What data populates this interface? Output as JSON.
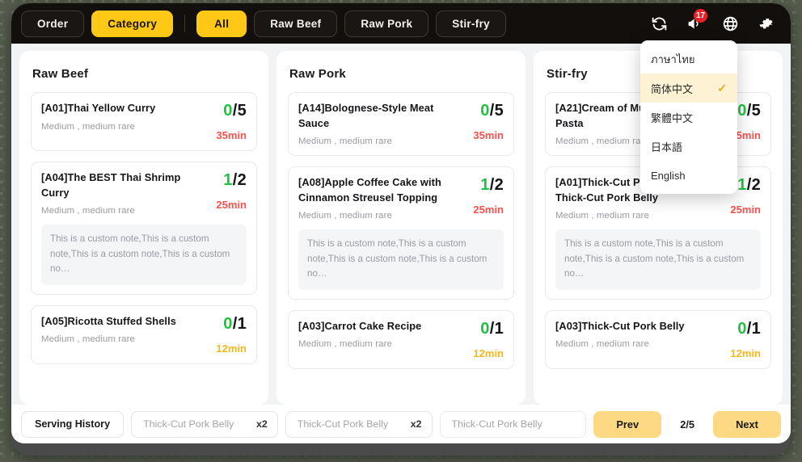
{
  "topbar": {
    "tabs": [
      {
        "label": "Order",
        "active": false
      },
      {
        "label": "Category",
        "active": true
      },
      {
        "label": "All",
        "active": true
      },
      {
        "label": "Raw Beef",
        "active": false
      },
      {
        "label": "Raw Pork",
        "active": false
      },
      {
        "label": "Stir-fry",
        "active": false
      }
    ],
    "icons": [
      {
        "name": "refresh-icon",
        "badge": null
      },
      {
        "name": "announcement-icon",
        "badge": "17"
      },
      {
        "name": "language-globe-icon",
        "badge": null
      },
      {
        "name": "settings-gear-icon",
        "badge": null
      }
    ],
    "accent": "#ffc816"
  },
  "language_menu": {
    "items": [
      {
        "label": "ภาษาไทย",
        "selected": false
      },
      {
        "label": "简体中文",
        "selected": true
      },
      {
        "label": "繁體中文",
        "selected": false
      },
      {
        "label": "日本語",
        "selected": false
      },
      {
        "label": "English",
        "selected": false
      }
    ],
    "check_glyph": "✓",
    "selected_bg": "#fdf3d4"
  },
  "columns": [
    {
      "title": "Raw Beef",
      "cards": [
        {
          "name": "[A01]Thai Yellow Curry",
          "desc": "Medium , medium rare",
          "done": "0",
          "total": "5",
          "time": "35min",
          "time_color": "red",
          "note": null
        },
        {
          "name": "[A04]The BEST Thai Shrimp Curry",
          "desc": "Medium , medium rare",
          "done": "1",
          "total": "2",
          "time": "25min",
          "time_color": "red",
          "note": "This is a custom note,This is a custom note,This is a custom note,This is a custom no…"
        },
        {
          "name": "[A05]Ricotta Stuffed Shells",
          "desc": "Medium , medium rare",
          "done": "0",
          "total": "1",
          "time": "12min",
          "time_color": "amber",
          "note": null
        }
      ]
    },
    {
      "title": "Raw Pork",
      "cards": [
        {
          "name": "[A14]Bolognese-Style Meat Sauce",
          "desc": "Medium , medium rare",
          "done": "0",
          "total": "5",
          "time": "35min",
          "time_color": "red",
          "note": null
        },
        {
          "name": "[A08]Apple Coffee Cake with Cinnamon Streusel Topping",
          "desc": "Medium , medium rare",
          "done": "1",
          "total": "2",
          "time": "25min",
          "time_color": "red",
          "note": "This is a custom note,This is a custom note,This is a custom note,This is a custom no…"
        },
        {
          "name": "[A03]Carrot Cake Recipe",
          "desc": "Medium , medium rare",
          "done": "0",
          "total": "1",
          "time": "12min",
          "time_color": "amber",
          "note": null
        }
      ]
    },
    {
      "title": "Stir-fry",
      "cards": [
        {
          "name": "[A21]Cream of Mushroom Pasta",
          "desc": "Medium , medium rare",
          "done": "0",
          "total": "5",
          "time": "35min",
          "time_color": "red",
          "note": null
        },
        {
          "name": "[A01]Thick-Cut Pork Belly Thick-Cut Pork Belly",
          "desc": "Medium , medium rare",
          "done": "1",
          "total": "2",
          "time": "25min",
          "time_color": "red",
          "note": "This is a custom note,This is a custom note,This is a custom note,This is a custom no…"
        },
        {
          "name": "[A03]Thick-Cut Pork Belly",
          "desc": "Medium , medium rare",
          "done": "0",
          "total": "1",
          "time": "12min",
          "time_color": "amber",
          "note": null
        }
      ]
    }
  ],
  "bottombar": {
    "history_label": "Serving History",
    "serving_items": [
      {
        "name": "Thick-Cut Pork Belly",
        "qty": "x2"
      },
      {
        "name": "Thick-Cut Pork Belly",
        "qty": "x2"
      },
      {
        "name": "Thick-Cut Pork Belly",
        "qty": ""
      }
    ],
    "prev_label": "Prev",
    "next_label": "Next",
    "page_indicator": "2/5",
    "page_button_color": "#fcd982"
  }
}
